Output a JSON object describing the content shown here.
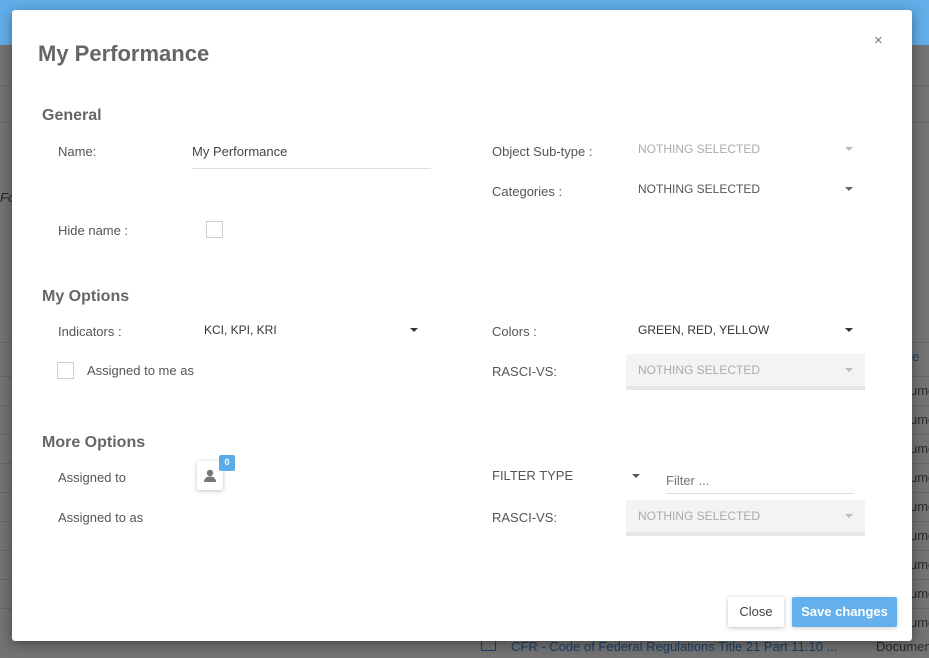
{
  "background": {
    "left_fragment": "Fo",
    "column_header_fragment": "e",
    "column_cells": [
      "umen",
      "umen",
      "umen",
      "umen",
      "umen",
      "umen",
      "umen",
      "umen",
      "umen"
    ],
    "bottom_link": "CFR - Code of Federal Regulations Title 21 Part 11.10 ...",
    "bottom_type": "Documen"
  },
  "modal": {
    "title": "My Performance",
    "close_icon": "×",
    "general": {
      "heading": "General",
      "name_label": "Name:",
      "name_value": "My Performance",
      "hide_name_label": "Hide name :",
      "hide_name_checked": false,
      "object_subtype_label": "Object Sub-type :",
      "object_subtype_value": "NOTHING SELECTED",
      "categories_label": "Categories :",
      "categories_value": "NOTHING SELECTED"
    },
    "my_options": {
      "heading": "My Options",
      "indicators_label": "Indicators :",
      "indicators_value": "KCI, KPI, KRI",
      "assigned_to_me_label": "Assigned to me as",
      "assigned_to_me_checked": false,
      "colors_label": "Colors :",
      "colors_value": "GREEN, RED, YELLOW",
      "rasci_label": "RASCI-VS:",
      "rasci_value": "NOTHING SELECTED"
    },
    "more_options": {
      "heading": "More Options",
      "assigned_to_label": "Assigned to",
      "assigned_count": "0",
      "assigned_to_as_label": "Assigned to as",
      "filter_type_label": "FILTER TYPE",
      "filter_placeholder": "Filter ...",
      "filter_value": "",
      "rasci_label": "RASCI-VS:",
      "rasci_value": "NOTHING SELECTED"
    },
    "footer": {
      "close_label": "Close",
      "save_label": "Save changes"
    }
  },
  "colors": {
    "accent": "#64b0ec",
    "header": "#62aee8"
  }
}
